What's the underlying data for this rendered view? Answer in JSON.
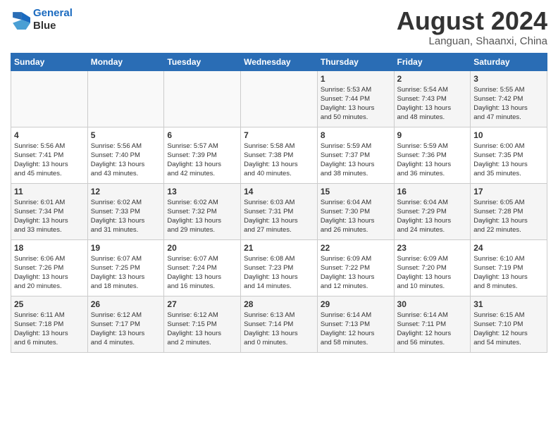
{
  "logo": {
    "line1": "General",
    "line2": "Blue"
  },
  "title": "August 2024",
  "location": "Languan, Shaanxi, China",
  "days_of_week": [
    "Sunday",
    "Monday",
    "Tuesday",
    "Wednesday",
    "Thursday",
    "Friday",
    "Saturday"
  ],
  "weeks": [
    [
      {
        "day": "",
        "info": ""
      },
      {
        "day": "",
        "info": ""
      },
      {
        "day": "",
        "info": ""
      },
      {
        "day": "",
        "info": ""
      },
      {
        "day": "1",
        "info": "Sunrise: 5:53 AM\nSunset: 7:44 PM\nDaylight: 13 hours\nand 50 minutes."
      },
      {
        "day": "2",
        "info": "Sunrise: 5:54 AM\nSunset: 7:43 PM\nDaylight: 13 hours\nand 48 minutes."
      },
      {
        "day": "3",
        "info": "Sunrise: 5:55 AM\nSunset: 7:42 PM\nDaylight: 13 hours\nand 47 minutes."
      }
    ],
    [
      {
        "day": "4",
        "info": "Sunrise: 5:56 AM\nSunset: 7:41 PM\nDaylight: 13 hours\nand 45 minutes."
      },
      {
        "day": "5",
        "info": "Sunrise: 5:56 AM\nSunset: 7:40 PM\nDaylight: 13 hours\nand 43 minutes."
      },
      {
        "day": "6",
        "info": "Sunrise: 5:57 AM\nSunset: 7:39 PM\nDaylight: 13 hours\nand 42 minutes."
      },
      {
        "day": "7",
        "info": "Sunrise: 5:58 AM\nSunset: 7:38 PM\nDaylight: 13 hours\nand 40 minutes."
      },
      {
        "day": "8",
        "info": "Sunrise: 5:59 AM\nSunset: 7:37 PM\nDaylight: 13 hours\nand 38 minutes."
      },
      {
        "day": "9",
        "info": "Sunrise: 5:59 AM\nSunset: 7:36 PM\nDaylight: 13 hours\nand 36 minutes."
      },
      {
        "day": "10",
        "info": "Sunrise: 6:00 AM\nSunset: 7:35 PM\nDaylight: 13 hours\nand 35 minutes."
      }
    ],
    [
      {
        "day": "11",
        "info": "Sunrise: 6:01 AM\nSunset: 7:34 PM\nDaylight: 13 hours\nand 33 minutes."
      },
      {
        "day": "12",
        "info": "Sunrise: 6:02 AM\nSunset: 7:33 PM\nDaylight: 13 hours\nand 31 minutes."
      },
      {
        "day": "13",
        "info": "Sunrise: 6:02 AM\nSunset: 7:32 PM\nDaylight: 13 hours\nand 29 minutes."
      },
      {
        "day": "14",
        "info": "Sunrise: 6:03 AM\nSunset: 7:31 PM\nDaylight: 13 hours\nand 27 minutes."
      },
      {
        "day": "15",
        "info": "Sunrise: 6:04 AM\nSunset: 7:30 PM\nDaylight: 13 hours\nand 26 minutes."
      },
      {
        "day": "16",
        "info": "Sunrise: 6:04 AM\nSunset: 7:29 PM\nDaylight: 13 hours\nand 24 minutes."
      },
      {
        "day": "17",
        "info": "Sunrise: 6:05 AM\nSunset: 7:28 PM\nDaylight: 13 hours\nand 22 minutes."
      }
    ],
    [
      {
        "day": "18",
        "info": "Sunrise: 6:06 AM\nSunset: 7:26 PM\nDaylight: 13 hours\nand 20 minutes."
      },
      {
        "day": "19",
        "info": "Sunrise: 6:07 AM\nSunset: 7:25 PM\nDaylight: 13 hours\nand 18 minutes."
      },
      {
        "day": "20",
        "info": "Sunrise: 6:07 AM\nSunset: 7:24 PM\nDaylight: 13 hours\nand 16 minutes."
      },
      {
        "day": "21",
        "info": "Sunrise: 6:08 AM\nSunset: 7:23 PM\nDaylight: 13 hours\nand 14 minutes."
      },
      {
        "day": "22",
        "info": "Sunrise: 6:09 AM\nSunset: 7:22 PM\nDaylight: 13 hours\nand 12 minutes."
      },
      {
        "day": "23",
        "info": "Sunrise: 6:09 AM\nSunset: 7:20 PM\nDaylight: 13 hours\nand 10 minutes."
      },
      {
        "day": "24",
        "info": "Sunrise: 6:10 AM\nSunset: 7:19 PM\nDaylight: 13 hours\nand 8 minutes."
      }
    ],
    [
      {
        "day": "25",
        "info": "Sunrise: 6:11 AM\nSunset: 7:18 PM\nDaylight: 13 hours\nand 6 minutes."
      },
      {
        "day": "26",
        "info": "Sunrise: 6:12 AM\nSunset: 7:17 PM\nDaylight: 13 hours\nand 4 minutes."
      },
      {
        "day": "27",
        "info": "Sunrise: 6:12 AM\nSunset: 7:15 PM\nDaylight: 13 hours\nand 2 minutes."
      },
      {
        "day": "28",
        "info": "Sunrise: 6:13 AM\nSunset: 7:14 PM\nDaylight: 13 hours\nand 0 minutes."
      },
      {
        "day": "29",
        "info": "Sunrise: 6:14 AM\nSunset: 7:13 PM\nDaylight: 12 hours\nand 58 minutes."
      },
      {
        "day": "30",
        "info": "Sunrise: 6:14 AM\nSunset: 7:11 PM\nDaylight: 12 hours\nand 56 minutes."
      },
      {
        "day": "31",
        "info": "Sunrise: 6:15 AM\nSunset: 7:10 PM\nDaylight: 12 hours\nand 54 minutes."
      }
    ]
  ]
}
